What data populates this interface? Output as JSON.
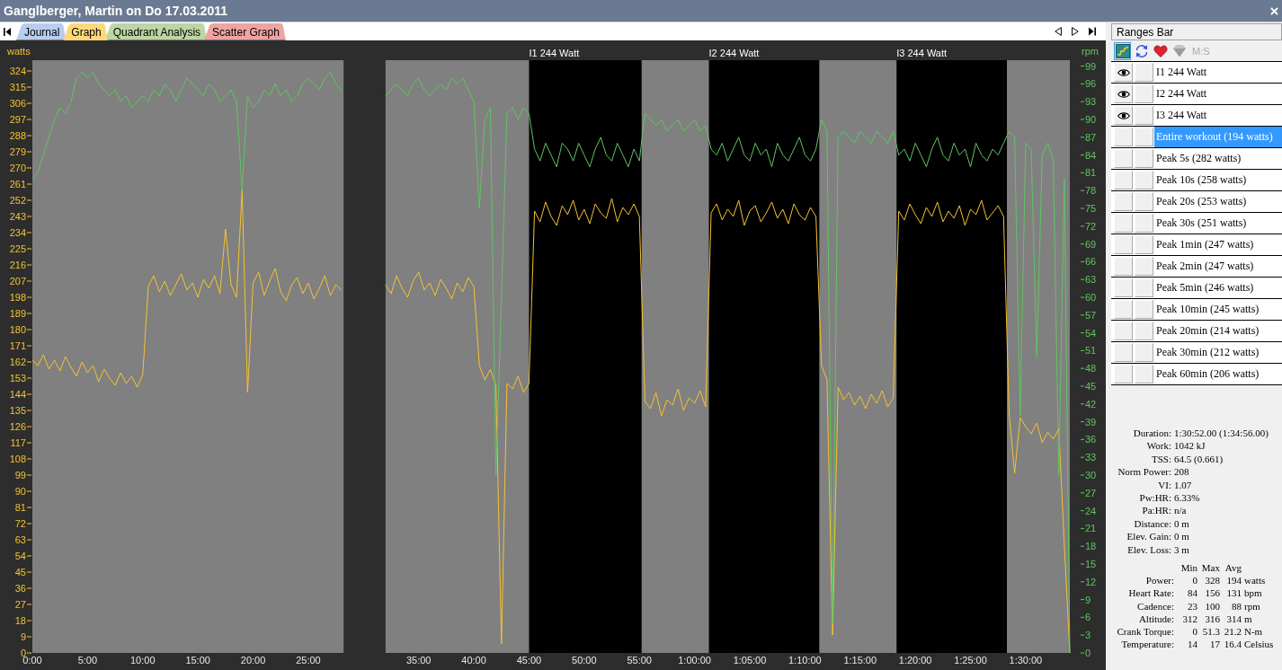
{
  "window": {
    "title": "Ganglberger, Martin on Do 17.03.2011"
  },
  "tabs": [
    {
      "label": "Journal",
      "color": "#b9cdf0",
      "selected": false
    },
    {
      "label": "Graph",
      "color": "#fdd77a",
      "selected": true
    },
    {
      "label": "Quadrant Analysis",
      "color": "#bcd6a4",
      "selected": false
    },
    {
      "label": "Scatter Graph",
      "color": "#f0a3a3",
      "selected": false
    }
  ],
  "graph": {
    "chart_data": {
      "type": "line",
      "x": [
        0,
        0.5,
        1,
        1.5,
        2,
        2.5,
        3,
        3.5,
        4,
        4.5,
        5,
        5.5,
        6,
        6.5,
        7,
        7.5,
        8,
        8.5,
        9,
        9.5,
        10,
        10.5,
        11,
        11.5,
        12,
        12.5,
        13,
        13.5,
        14,
        14.5,
        15,
        15.5,
        16,
        16.5,
        17,
        17.5,
        18,
        18.5,
        19,
        19.5,
        20,
        20.5,
        21,
        21.5,
        22,
        22.5,
        23,
        23.5,
        24,
        24.5,
        25,
        25.5,
        26,
        26.5,
        27,
        27.5,
        28,
        32,
        32.5,
        33,
        33.5,
        34,
        34.5,
        35,
        35.5,
        36,
        36.5,
        37,
        37.5,
        38,
        38.5,
        39,
        39.5,
        40,
        40.5,
        41,
        41.5,
        42,
        42.5,
        43,
        43.5,
        44,
        44.5,
        45,
        45.5,
        46,
        46.5,
        47,
        47.5,
        48,
        48.5,
        49,
        49.5,
        50,
        50.5,
        51,
        51.5,
        52,
        52.5,
        53,
        53.5,
        54,
        54.5,
        55,
        55.5,
        56,
        56.5,
        57,
        57.5,
        58,
        58.5,
        59,
        59.5,
        60,
        60.5,
        61,
        61.5,
        62,
        62.5,
        63,
        63.5,
        64,
        64.5,
        65,
        65.5,
        66,
        66.5,
        67,
        67.5,
        68,
        68.5,
        69,
        69.5,
        70,
        70.5,
        71,
        71.5,
        72,
        72.5,
        73,
        73.5,
        74,
        74.5,
        75,
        75.5,
        76,
        76.5,
        77,
        77.5,
        78,
        78.5,
        79,
        79.5,
        80,
        80.5,
        81,
        81.5,
        82,
        82.5,
        83,
        83.5,
        84,
        84.5,
        85,
        85.5,
        86,
        86.5,
        87,
        87.5,
        88,
        88.5,
        89,
        89.5,
        90,
        90.5,
        91,
        91.5,
        92,
        92.5,
        93,
        93.5,
        94
      ],
      "xlim": [
        0,
        94
      ],
      "ylim": [
        0,
        330
      ],
      "y2lim": [
        0,
        100
      ],
      "xticks": [
        {
          "value": 0,
          "label": "0:00"
        },
        {
          "value": 5,
          "label": "5:00"
        },
        {
          "value": 10,
          "label": "10:00"
        },
        {
          "value": 15,
          "label": "15:00"
        },
        {
          "value": 20,
          "label": "20:00"
        },
        {
          "value": 25,
          "label": "25:00"
        },
        {
          "value": 35,
          "label": "35:00"
        },
        {
          "value": 40,
          "label": "40:00"
        },
        {
          "value": 45,
          "label": "45:00"
        },
        {
          "value": 50,
          "label": "50:00"
        },
        {
          "value": 55,
          "label": "55:00"
        },
        {
          "value": 60,
          "label": "1:00:00"
        },
        {
          "value": 65,
          "label": "1:05:00"
        },
        {
          "value": 70,
          "label": "1:10:00"
        },
        {
          "value": 75,
          "label": "1:15:00"
        },
        {
          "value": 80,
          "label": "1:20:00"
        },
        {
          "value": 85,
          "label": "1:25:00"
        },
        {
          "value": 90,
          "label": "1:30:00"
        }
      ],
      "yticks": [
        0,
        9,
        18,
        27,
        36,
        45,
        54,
        63,
        72,
        81,
        90,
        99,
        108,
        117,
        126,
        135,
        144,
        153,
        162,
        171,
        180,
        189,
        198,
        207,
        216,
        225,
        234,
        243,
        252,
        261,
        270,
        279,
        288,
        297,
        306,
        315,
        324
      ],
      "y2ticks": [
        0,
        3,
        6,
        9,
        12,
        15,
        18,
        21,
        24,
        27,
        30,
        33,
        36,
        39,
        42,
        45,
        48,
        51,
        54,
        57,
        60,
        63,
        66,
        69,
        72,
        75,
        78,
        81,
        84,
        87,
        90,
        93,
        96,
        99
      ],
      "series": [
        {
          "name": "watts",
          "color": "#f5c332",
          "values": [
            163,
            160,
            166,
            158,
            163,
            157,
            165,
            159,
            154,
            162,
            156,
            160,
            151,
            158,
            153,
            149,
            156,
            150,
            154,
            148,
            155,
            204,
            210,
            201,
            207,
            199,
            205,
            211,
            202,
            206,
            198,
            208,
            203,
            210,
            200,
            236,
            205,
            198,
            258,
            145,
            206,
            212,
            199,
            207,
            214,
            201,
            196,
            205,
            209,
            200,
            206,
            197,
            203,
            210,
            199,
            205,
            202,
            205,
            200,
            210,
            203,
            198,
            207,
            212,
            202,
            206,
            199,
            208,
            203,
            197,
            206,
            201,
            209,
            204,
            160,
            152,
            158,
            149,
            5,
            150,
            147,
            154,
            145,
            150,
            246,
            240,
            251,
            243,
            238,
            249,
            244,
            252,
            241,
            247,
            239,
            250,
            245,
            242,
            253,
            240,
            248,
            244,
            250,
            243,
            140,
            136,
            145,
            132,
            141,
            138,
            147,
            135,
            142,
            139,
            146,
            137,
            245,
            250,
            241,
            247,
            243,
            252,
            238,
            246,
            249,
            240,
            245,
            251,
            242,
            247,
            239,
            250,
            244,
            241,
            248,
            243,
            160,
            152,
            10,
            148,
            141,
            145,
            138,
            143,
            136,
            144,
            139,
            146,
            137,
            142,
            246,
            241,
            250,
            244,
            239,
            248,
            243,
            251,
            240,
            246,
            242,
            249,
            238,
            247,
            244,
            252,
            241,
            245,
            249,
            243,
            133,
            100,
            131,
            126,
            122,
            128,
            117,
            123,
            119,
            125,
            60,
            0
          ]
        },
        {
          "name": "rpm",
          "axis": "y2",
          "color": "#62c462",
          "values": [
            80,
            81,
            84,
            87,
            90,
            92,
            91,
            93,
            97,
            98,
            97,
            98,
            96,
            95,
            94,
            95,
            93,
            94,
            92,
            93,
            94,
            93,
            95,
            94,
            96,
            95,
            93,
            95,
            97,
            96,
            95,
            94,
            96,
            95,
            93,
            94,
            95,
            93,
            78,
            94,
            92,
            93,
            95,
            94,
            96,
            94,
            95,
            93,
            94,
            96,
            97,
            96,
            95,
            97,
            98,
            96,
            95,
            94,
            95,
            96,
            95,
            94,
            96,
            97,
            95,
            94,
            95,
            96,
            95,
            97,
            96,
            97,
            95,
            93,
            75,
            90,
            92,
            30,
            60,
            91,
            92,
            90,
            92,
            91,
            85,
            83,
            86,
            84,
            82,
            86,
            85,
            83,
            86,
            84,
            82,
            85,
            87,
            84,
            83,
            86,
            84,
            82,
            85,
            83,
            91,
            90,
            89,
            90,
            88,
            89,
            90,
            88,
            89,
            90,
            88,
            89,
            85,
            84,
            86,
            83,
            85,
            87,
            84,
            83,
            86,
            84,
            85,
            82,
            86,
            84,
            83,
            85,
            87,
            84,
            83,
            85,
            90,
            88,
            5,
            87,
            88,
            87,
            86,
            88,
            87,
            86,
            88,
            87,
            86,
            88,
            84,
            85,
            83,
            86,
            84,
            82,
            85,
            87,
            84,
            83,
            86,
            84,
            85,
            82,
            86,
            84,
            83,
            85,
            84,
            86,
            88,
            87,
            40,
            86,
            85,
            50,
            84,
            86,
            83,
            30,
            80,
            0
          ]
        }
      ],
      "bands": [
        {
          "axis": "x",
          "from": 28.2,
          "to": 32,
          "color": "#2d2d2d"
        },
        {
          "axis": "x",
          "from": 45,
          "to": 55.2,
          "color": "#000000",
          "label": "I1 244 Watt"
        },
        {
          "axis": "x",
          "from": 61.3,
          "to": 71.3,
          "color": "#000000",
          "label": "I2 244 Watt"
        },
        {
          "axis": "x",
          "from": 78.3,
          "to": 88.3,
          "color": "#000000",
          "label": "I3 244 Watt"
        }
      ]
    }
  },
  "ranges_bar": {
    "title": "Ranges Bar",
    "toolbar": [
      {
        "kind": "chart",
        "pressed": true,
        "disabled": false
      },
      {
        "kind": "refresh",
        "pressed": false,
        "disabled": false
      },
      {
        "kind": "heart",
        "pressed": false,
        "disabled": false
      },
      {
        "kind": "gem",
        "pressed": false,
        "disabled": true
      },
      {
        "kind": "text",
        "label": "M:S",
        "pressed": false,
        "disabled": true
      }
    ],
    "items": [
      {
        "label": "I1 244 Watt",
        "visible": true,
        "checked": false,
        "selected": false
      },
      {
        "label": "I2 244 Watt",
        "visible": true,
        "checked": false,
        "selected": false
      },
      {
        "label": "I3 244 Watt",
        "visible": true,
        "checked": false,
        "selected": false
      },
      {
        "label": "Entire workout (194 watts)",
        "visible": false,
        "checked": false,
        "selected": true
      },
      {
        "label": "Peak 5s (282 watts)",
        "visible": false,
        "checked": false,
        "selected": false
      },
      {
        "label": "Peak 10s (258 watts)",
        "visible": false,
        "checked": false,
        "selected": false
      },
      {
        "label": "Peak 20s (253 watts)",
        "visible": false,
        "checked": false,
        "selected": false
      },
      {
        "label": "Peak 30s (251 watts)",
        "visible": false,
        "checked": false,
        "selected": false
      },
      {
        "label": "Peak 1min (247 watts)",
        "visible": false,
        "checked": false,
        "selected": false
      },
      {
        "label": "Peak 2min (247 watts)",
        "visible": false,
        "checked": false,
        "selected": false
      },
      {
        "label": "Peak 5min (246 watts)",
        "visible": false,
        "checked": false,
        "selected": false
      },
      {
        "label": "Peak 10min (245 watts)",
        "visible": false,
        "checked": false,
        "selected": false
      },
      {
        "label": "Peak 20min (214 watts)",
        "visible": false,
        "checked": false,
        "selected": false
      },
      {
        "label": "Peak 30min (212 watts)",
        "visible": false,
        "checked": false,
        "selected": false
      },
      {
        "label": "Peak 60min (206 watts)",
        "visible": false,
        "checked": false,
        "selected": false
      }
    ]
  },
  "summary": [
    {
      "label": "Duration:",
      "value": "1:30:52.00 (1:34:56.00)"
    },
    {
      "label": "Work:",
      "value": "1042 kJ"
    },
    {
      "label": "TSS:",
      "value": "64.5 (0.661)"
    },
    {
      "label": "Norm Power:",
      "value": "208"
    },
    {
      "label": "VI:",
      "value": "1.07"
    },
    {
      "label": "Pw:HR:",
      "value": "6.33%"
    },
    {
      "label": "Pa:HR:",
      "value": "n/a"
    },
    {
      "label": "Distance:",
      "value": "0 m"
    },
    {
      "label": "Elev. Gain:",
      "value": "0 m"
    },
    {
      "label": "Elev. Loss:",
      "value": "3 m"
    }
  ],
  "stats_table": {
    "columns": [
      "Min",
      "Max",
      "Avg"
    ],
    "rows": [
      {
        "label": "Power:",
        "min": "0",
        "max": "328",
        "avg": "194",
        "unit": "watts"
      },
      {
        "label": "Heart Rate:",
        "min": "84",
        "max": "156",
        "avg": "131",
        "unit": "bpm"
      },
      {
        "label": "Cadence:",
        "min": "23",
        "max": "100",
        "avg": "88",
        "unit": "rpm"
      },
      {
        "label": "Altitude:",
        "min": "312",
        "max": "316",
        "avg": "314",
        "unit": "m"
      },
      {
        "label": "Crank Torque:",
        "min": "0",
        "max": "51.3",
        "avg": "21.2",
        "unit": "N-m"
      },
      {
        "label": "Temperature:",
        "min": "14",
        "max": "17",
        "avg": "16.4",
        "unit": "Celsius"
      }
    ]
  }
}
